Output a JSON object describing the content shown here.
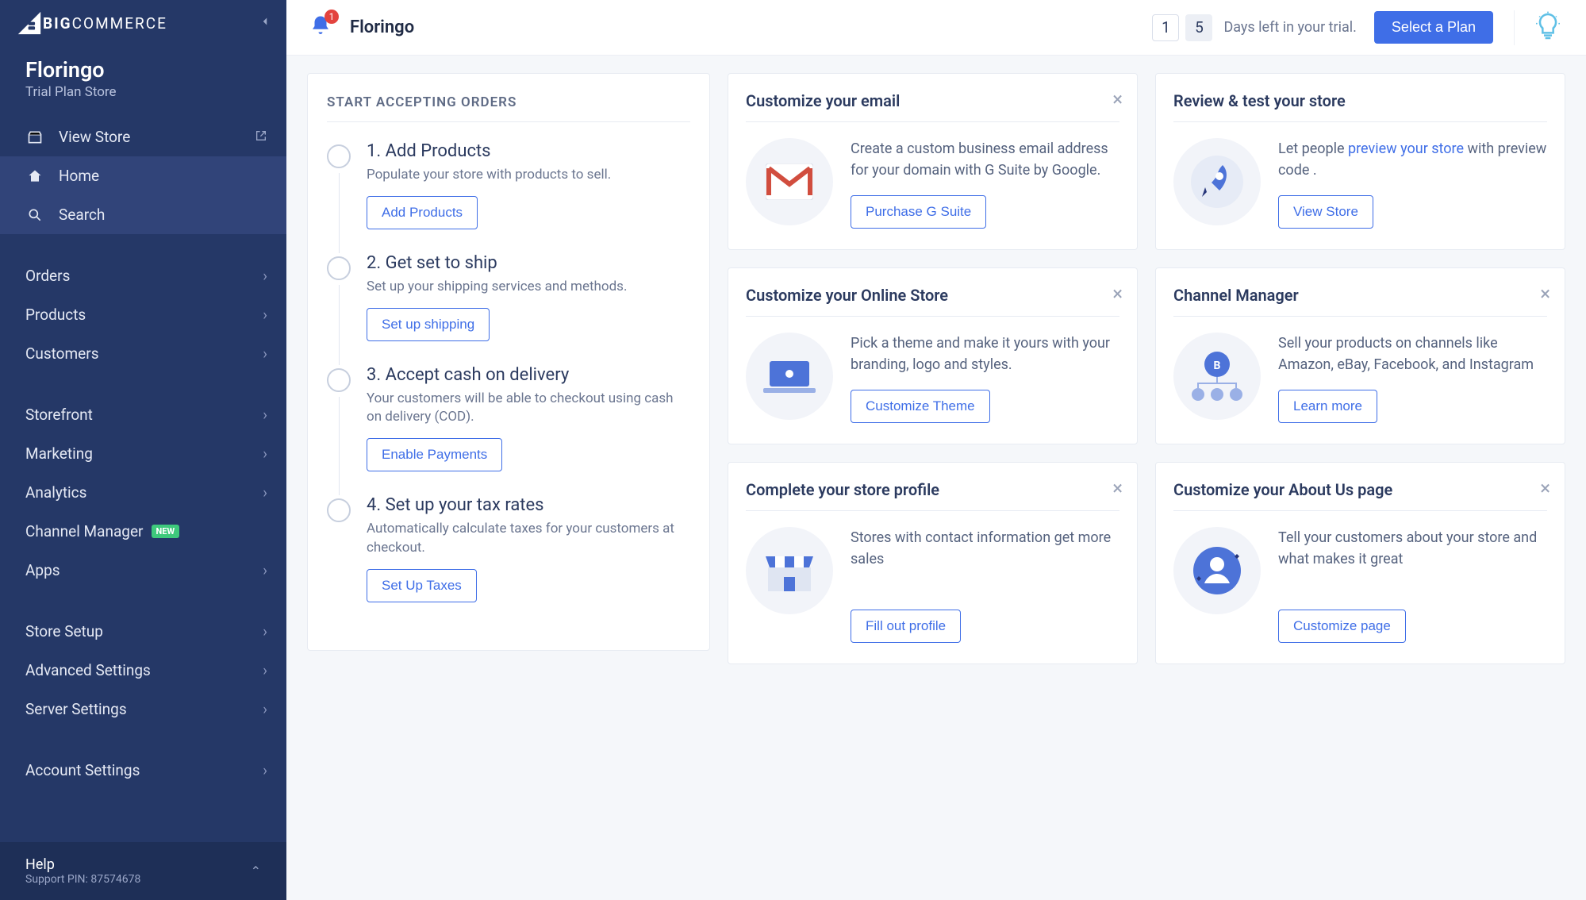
{
  "brand": {
    "prefix": "BIG",
    "suffix": "COMMERCE"
  },
  "store": {
    "name": "Floringo",
    "plan": "Trial Plan Store"
  },
  "nav": {
    "view_store": "View Store",
    "home": "Home",
    "search": "Search",
    "orders": "Orders",
    "products": "Products",
    "customers": "Customers",
    "storefront": "Storefront",
    "marketing": "Marketing",
    "analytics": "Analytics",
    "channel_manager": "Channel Manager",
    "channel_new": "NEW",
    "apps": "Apps",
    "store_setup": "Store Setup",
    "advanced_settings": "Advanced Settings",
    "server_settings": "Server Settings",
    "account_settings": "Account Settings"
  },
  "help": {
    "title": "Help",
    "sub": "Support PIN: 87574678"
  },
  "topbar": {
    "title": "Floringo",
    "bell_count": "1",
    "trial_day1": "1",
    "trial_day2": "5",
    "trial_text": "Days left in your trial.",
    "select_plan": "Select a Plan"
  },
  "left": {
    "heading": "START ACCEPTING ORDERS",
    "steps": [
      {
        "title": "1. Add Products",
        "desc": "Populate your store with products to sell.",
        "button": "Add Products"
      },
      {
        "title": "2. Get set to ship",
        "desc": "Set up your shipping services and methods.",
        "button": "Set up shipping"
      },
      {
        "title": "3. Accept cash on delivery",
        "desc": "Your customers will be able to checkout using cash on delivery (COD).",
        "button": "Enable Payments"
      },
      {
        "title": "4. Set up your tax rates",
        "desc": "Automatically calculate taxes for your customers at checkout.",
        "button": "Set Up Taxes"
      }
    ]
  },
  "tiles": {
    "email": {
      "title": "Customize your email",
      "text": "Create a custom business email address for your domain with G Suite by Google.",
      "button": "Purchase G Suite"
    },
    "review": {
      "title": "Review & test your store",
      "text_pre": "Let people ",
      "link": "preview your store",
      "text_post": " with preview code .",
      "button": "View Store"
    },
    "online": {
      "title": "Customize your Online Store",
      "text": "Pick a theme and make it yours with your branding, logo and styles.",
      "button": "Customize Theme"
    },
    "channel": {
      "title": "Channel Manager",
      "text": "Sell your products on channels like Amazon, eBay, Facebook, and Instagram",
      "button": "Learn more"
    },
    "profile": {
      "title": "Complete your store profile",
      "text": "Stores with contact information get more sales",
      "button": "Fill out profile"
    },
    "about": {
      "title": "Customize your About Us page",
      "text": "Tell your customers about your store and what makes it great",
      "button": "Customize page"
    }
  }
}
